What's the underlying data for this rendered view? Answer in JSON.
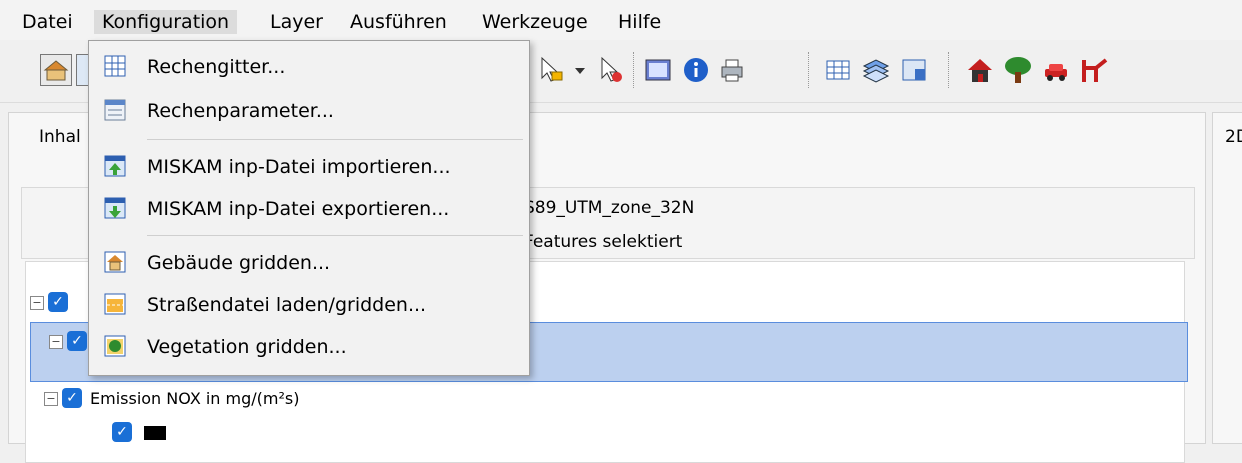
{
  "menubar": {
    "items": [
      "Datei",
      "Konfiguration",
      "Layer",
      "Ausführen",
      "Werkzeuge",
      "Hilfe"
    ]
  },
  "dropdown": {
    "items": [
      {
        "label": "Rechengitter...",
        "icon": "grid-icon"
      },
      {
        "label": "Rechenparameter...",
        "icon": "parameters-icon"
      },
      {
        "label": "MISKAM inp-Datei importieren...",
        "icon": "import-icon"
      },
      {
        "label": "MISKAM inp-Datei exportieren...",
        "icon": "export-icon"
      },
      {
        "label": "Gebäude gridden...",
        "icon": "building-icon"
      },
      {
        "label": "Straßendatei laden/gridden...",
        "icon": "street-icon"
      },
      {
        "label": "Vegetation gridden...",
        "icon": "vegetation-icon"
      }
    ]
  },
  "panels": {
    "left_tab": "Inhal",
    "right_tab": "2D",
    "crs_text": "S89_UTM_zone_32N",
    "selection_text": "Features selektiert"
  },
  "layers": {
    "emission_label": "Emission NOX in mg/(m²s)"
  },
  "colors": {
    "selection": "#bcd0ef",
    "selection_border": "#5a8ddd",
    "checkbox": "#1a6fd6"
  }
}
